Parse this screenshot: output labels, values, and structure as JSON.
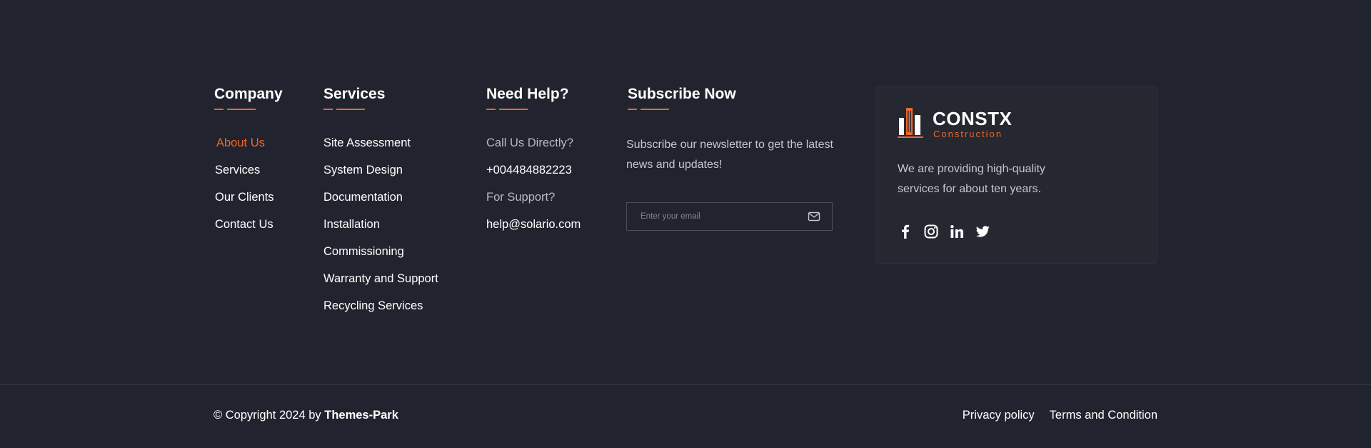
{
  "company": {
    "heading": "Company",
    "links": [
      "About Us",
      "Services",
      "Our Clients",
      "Contact Us"
    ]
  },
  "services": {
    "heading": "Services",
    "links": [
      "Site Assessment",
      "System Design",
      "Documentation",
      "Installation",
      "Commissioning",
      "Warranty and Support",
      "Recycling Services"
    ]
  },
  "help": {
    "heading": "Need Help?",
    "call_label": "Call Us Directly?",
    "phone": "+004484882223",
    "support_label": "For Support?",
    "email": "help@solario.com"
  },
  "subscribe": {
    "heading": "Subscribe Now",
    "text": "Subscribe our newsletter to get the latest news and updates!",
    "placeholder": "Enter your email",
    "submit_icon": "envelope-icon"
  },
  "brand": {
    "name": "CONSTX",
    "tagline": "Construction",
    "description": "We are providing high-quality services for about ten years.",
    "socials": [
      "facebook-icon",
      "instagram-icon",
      "linkedin-icon",
      "twitter-icon"
    ]
  },
  "bottom": {
    "copyright_prefix": "© Copyright 2024 by ",
    "copyright_owner": "Themes-Park",
    "privacy": "Privacy policy",
    "terms": "Terms and Condition"
  },
  "colors": {
    "background": "#21242e",
    "accent": "#f2672a",
    "card": "#252831",
    "text": "#ffffff",
    "muted": "#c5c8d0"
  }
}
